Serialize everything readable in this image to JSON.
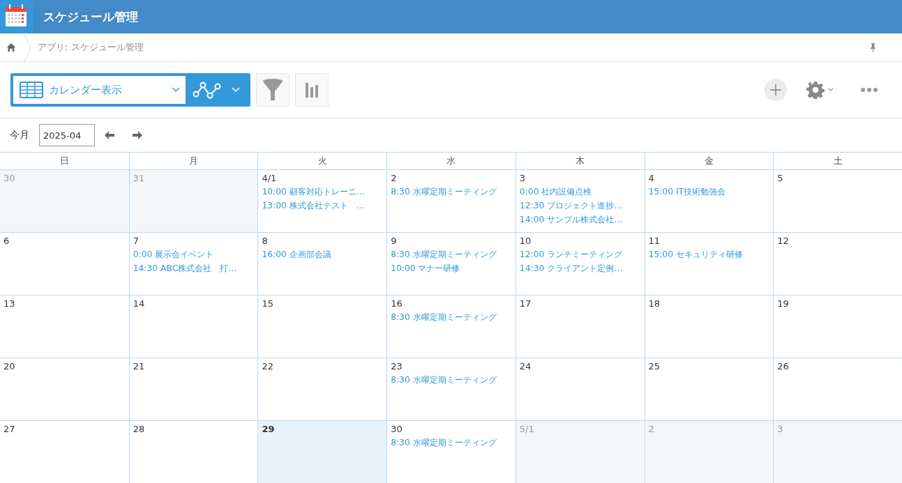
{
  "app": {
    "title": "スケジュール管理"
  },
  "breadcrumb": {
    "path": "アプリ: スケジュール管理"
  },
  "toolbar": {
    "view": "カレンダー表示"
  },
  "month_nav": {
    "today_label": "今月",
    "month": "2025-04"
  },
  "calendar": {
    "weekdays": [
      "日",
      "月",
      "火",
      "水",
      "木",
      "金",
      "土"
    ],
    "weeks": [
      [
        {
          "date": "30",
          "other_month": true,
          "today": false
        },
        {
          "date": "31",
          "other_month": true,
          "today": false
        },
        {
          "date": "4/1",
          "other_month": false,
          "today": false,
          "events": [
            "10:00 顧客対応トレーニ…",
            "13:00 株式会社テスト　…"
          ]
        },
        {
          "date": "2",
          "other_month": false,
          "today": false,
          "events": [
            "8:30 水曜定期ミーティング"
          ]
        },
        {
          "date": "3",
          "other_month": false,
          "today": false,
          "events": [
            "0:00 社内設備点検",
            "12:30 プロジェクト進捗…",
            "14:00 サンプル株式会社…"
          ]
        },
        {
          "date": "4",
          "other_month": false,
          "today": false,
          "events": [
            "15:00 IT技術勉強会"
          ]
        },
        {
          "date": "5",
          "other_month": false,
          "today": false
        }
      ],
      [
        {
          "date": "6",
          "other_month": false,
          "today": false
        },
        {
          "date": "7",
          "other_month": false,
          "today": false,
          "events": [
            "0:00 展示会イベント",
            "14:30 ABC株式会社　打…"
          ]
        },
        {
          "date": "8",
          "other_month": false,
          "today": false,
          "events": [
            "16:00 企画部会議"
          ]
        },
        {
          "date": "9",
          "other_month": false,
          "today": false,
          "events": [
            "8:30 水曜定期ミーティング",
            "10:00 マナー研修"
          ]
        },
        {
          "date": "10",
          "other_month": false,
          "today": false,
          "events": [
            "12:00 ランチミーティング",
            "14:30 クライアント定例…"
          ]
        },
        {
          "date": "11",
          "other_month": false,
          "today": false,
          "events": [
            "15:00 セキュリティ研修"
          ]
        },
        {
          "date": "12",
          "other_month": false,
          "today": false
        }
      ],
      [
        {
          "date": "13",
          "other_month": false,
          "today": false
        },
        {
          "date": "14",
          "other_month": false,
          "today": false
        },
        {
          "date": "15",
          "other_month": false,
          "today": false
        },
        {
          "date": "16",
          "other_month": false,
          "today": false,
          "events": [
            "8:30 水曜定期ミーティング"
          ]
        },
        {
          "date": "17",
          "other_month": false,
          "today": false
        },
        {
          "date": "18",
          "other_month": false,
          "today": false
        },
        {
          "date": "19",
          "other_month": false,
          "today": false
        }
      ],
      [
        {
          "date": "20",
          "other_month": false,
          "today": false
        },
        {
          "date": "21",
          "other_month": false,
          "today": false
        },
        {
          "date": "22",
          "other_month": false,
          "today": false
        },
        {
          "date": "23",
          "other_month": false,
          "today": false,
          "events": [
            "8:30 水曜定期ミーティング"
          ]
        },
        {
          "date": "24",
          "other_month": false,
          "today": false
        },
        {
          "date": "25",
          "other_month": false,
          "today": false
        },
        {
          "date": "26",
          "other_month": false,
          "today": false
        }
      ],
      [
        {
          "date": "27",
          "other_month": false,
          "today": false
        },
        {
          "date": "28",
          "other_month": false,
          "today": false
        },
        {
          "date": "29",
          "other_month": false,
          "today": true
        },
        {
          "date": "30",
          "other_month": false,
          "today": false,
          "events": [
            "8:30 水曜定期ミーティング"
          ]
        },
        {
          "date": "5/1",
          "other_month": true,
          "today": false
        },
        {
          "date": "2",
          "other_month": true,
          "today": false
        },
        {
          "date": "3",
          "other_month": true,
          "today": false
        }
      ]
    ]
  }
}
